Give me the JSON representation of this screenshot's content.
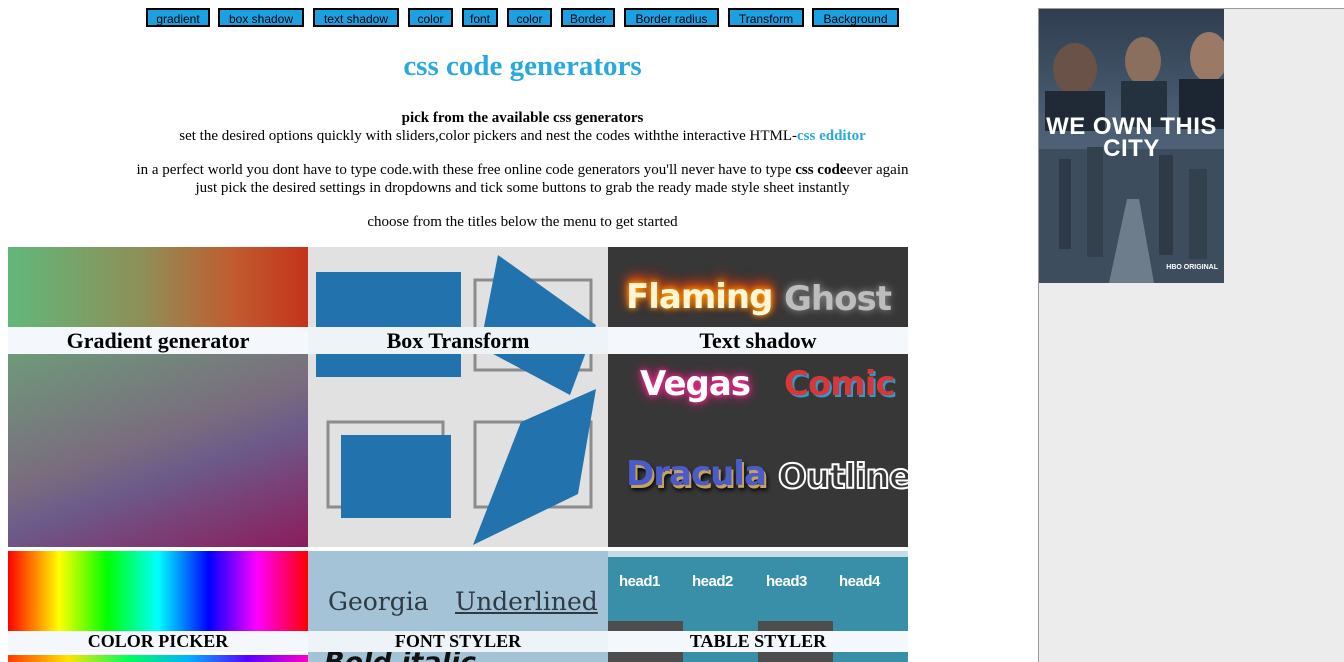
{
  "nav": {
    "items": [
      "gradient",
      "box shadow",
      "text shadow",
      "color",
      "font",
      "color",
      "Border",
      "Border radius",
      "Transform",
      "Background"
    ]
  },
  "header": {
    "title": "css code generators"
  },
  "intro": {
    "line1": "pick from the available css generators",
    "line2_prefix": "set the desired options quickly with sliders,color pickers and nest the codes withthe interactive HTML-",
    "line2_link": "css edditor",
    "line3_prefix": "in a perfect world you dont have to type code.with these free online code generators you'll never have to type ",
    "line3_bold": "css code",
    "line3_suffix": "ever again",
    "line4": "just pick the desired settings in dropdowns and tick some buttons to grab the ready made style sheet instantly",
    "line5": "choose from the titles below the menu to get started"
  },
  "tiles": {
    "gradient": {
      "caption": "Gradient generator"
    },
    "box_transform": {
      "caption": "Box Transform"
    },
    "text_shadow": {
      "caption": "Text shadow",
      "samples": [
        "Flaming",
        "Ghost",
        "Vegas",
        "Comic",
        "Dracula",
        "Outline"
      ]
    },
    "color_picker": {
      "caption": "COLOR PICKER"
    },
    "font_styler": {
      "caption": "FONT STYLER",
      "samples": [
        "Georgia",
        "Underlined",
        "Bold italic"
      ]
    },
    "table_styler": {
      "caption": "TABLE STYLER",
      "headers": [
        "head1",
        "head2",
        "head3",
        "head4"
      ]
    }
  },
  "ad": {
    "title": "WE OWN THIS CITY",
    "badge": "HBO ORIGINAL"
  },
  "colors": {
    "accent": "#29a9dd",
    "nav_button": "#1ba1e2",
    "sidebar": "#ececec"
  }
}
